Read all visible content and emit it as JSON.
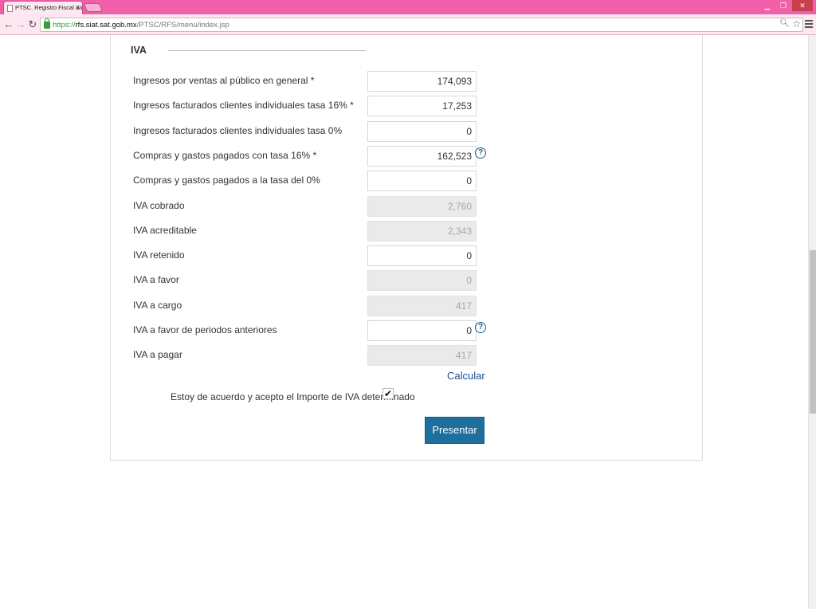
{
  "browser": {
    "tab_title": "PTSC. Registro Fiscal Simp",
    "tab_close": "×",
    "url_scheme": "https://",
    "url_host": "rfs.siat.sat.gob.mx",
    "url_path": "/PTSC/RFS/menu/index.jsp",
    "icons": {
      "back": "arrow-left",
      "forward": "arrow-right",
      "reload": "reload",
      "secure": "lock",
      "zoom": "magnifier",
      "bookmark": "star",
      "menu": "hamburger"
    },
    "colors": {
      "frame": "#f05fa8",
      "toolbar": "#fde8f2"
    }
  },
  "form": {
    "section_title": "IVA",
    "fields": [
      {
        "label": "Ingresos por ventas al público en general *",
        "value": "174,093",
        "readonly": false,
        "help": false
      },
      {
        "label": "Ingresos facturados clientes individuales tasa 16% *",
        "value": "17,253",
        "readonly": false,
        "help": false
      },
      {
        "label": "Ingresos facturados clientes individuales tasa 0%",
        "value": "0",
        "readonly": false,
        "help": false
      },
      {
        "label": "Compras y gastos pagados con tasa 16% *",
        "value": "162,523",
        "readonly": false,
        "help": true
      },
      {
        "label": "Compras y gastos pagados a la tasa del 0%",
        "value": "0",
        "readonly": false,
        "help": false
      },
      {
        "label": "IVA cobrado",
        "value": "2,760",
        "readonly": true,
        "help": false
      },
      {
        "label": "IVA acreditable",
        "value": "2,343",
        "readonly": true,
        "help": false
      },
      {
        "label": "IVA retenido",
        "value": "0",
        "readonly": false,
        "help": false
      },
      {
        "label": "IVA a favor",
        "value": "0",
        "readonly": true,
        "help": false
      },
      {
        "label": "IVA a cargo",
        "value": "417",
        "readonly": true,
        "help": false
      },
      {
        "label": "IVA a favor de periodos anteriores",
        "value": "0",
        "readonly": false,
        "help": true
      },
      {
        "label": "IVA a pagar",
        "value": "417",
        "readonly": true,
        "help": false
      }
    ],
    "help_glyph": "?",
    "calc_link": "Calcular",
    "agree_text": "Estoy de acuerdo y acepto el Importe de IVA determinado",
    "agree_checked": true,
    "agree_glyph": "✔",
    "submit_label": "Presentar",
    "colors": {
      "button": "#1f6f9e",
      "link": "#1f4e8c",
      "readonly_bg": "#eaeaea"
    }
  }
}
